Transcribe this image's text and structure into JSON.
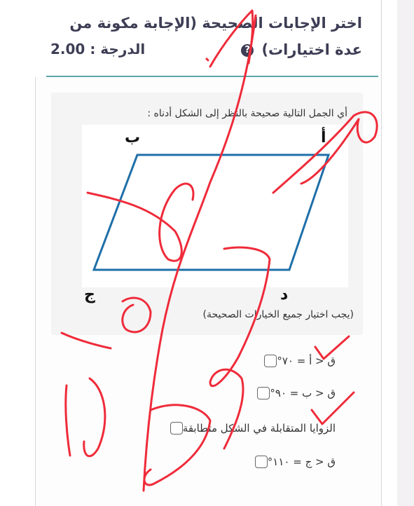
{
  "header": {
    "title_line1": "اختر الإجابات الصحيحة (الإجابة مكونة من",
    "title_line2": "عدة اختيارات)",
    "help_icon": "question-circle-icon",
    "grade_label": "الدرجة : 2.00"
  },
  "question": {
    "prompt": "أي الجمل التالية صحيحة بالنظر إلى الشكل أدناه :",
    "hint": "(يجب اختيار جميع الخيارات الصحيحة)",
    "vertices": {
      "a": "أ",
      "b": "ب",
      "c": "ج",
      "d": "د"
    }
  },
  "options": [
    {
      "label": "ق < أ = ٧٠°",
      "checked": false
    },
    {
      "label": "ق < ب = ٩٠°",
      "checked": false
    },
    {
      "label": "الزوايا المتقابلة في الشكل متطابقة",
      "checked": false
    },
    {
      "label": "ق < ج = ١١٠°",
      "checked": false
    }
  ],
  "colors": {
    "title": "#3d3d55",
    "accent_rule": "#5aa7a6",
    "shape_stroke": "#1f6fa8",
    "ink": "#ef2b3a"
  }
}
